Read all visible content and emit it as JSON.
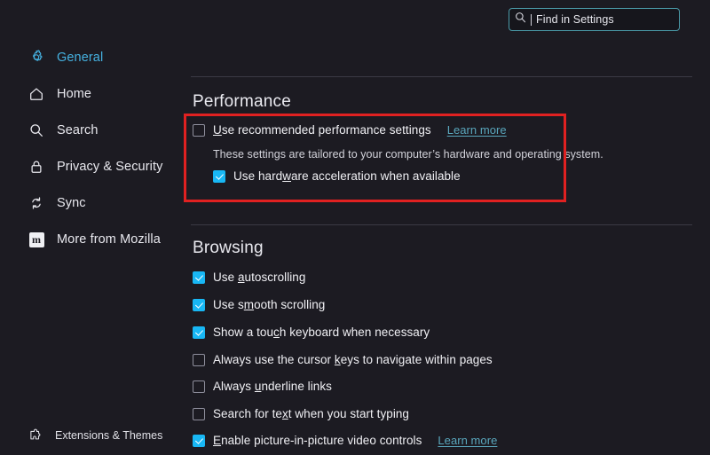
{
  "search": {
    "name": "find-in-settings",
    "placeholder": "Find in Settings",
    "value": "Find in Settings",
    "icon": "search-icon",
    "border_color": "#4a9aa8"
  },
  "sidebar": {
    "items": [
      {
        "label": "General",
        "icon": "gear-icon",
        "active": true
      },
      {
        "label": "Home",
        "icon": "home-icon",
        "active": false
      },
      {
        "label": "Search",
        "icon": "search-icon",
        "active": false
      },
      {
        "label": "Privacy & Security",
        "icon": "lock-icon",
        "active": false
      },
      {
        "label": "Sync",
        "icon": "sync-icon",
        "active": false
      },
      {
        "label": "More from Mozilla",
        "icon": "mozilla-m-icon",
        "active": false
      }
    ],
    "bottom": {
      "label": "Extensions & Themes",
      "icon": "puzzle-piece-icon"
    },
    "active_color": "#45b1e0"
  },
  "main": {
    "performance": {
      "title": "Performance",
      "recommended": {
        "label_pre": "U",
        "label_post": "se recommended performance settings",
        "checked": false,
        "link": "Learn more"
      },
      "description": "These settings are tailored to your computer’s hardware and operating system.",
      "hardware_acceleration": {
        "label_pre": "Use hard",
        "label_key": "w",
        "label_post": "are acceleration when available",
        "checked": true
      }
    },
    "browsing": {
      "title": "Browsing",
      "options": [
        {
          "pre": "Use ",
          "key": "a",
          "post": "utoscrolling",
          "checked": true,
          "link": null
        },
        {
          "pre": "Use s",
          "key": "m",
          "post": "ooth scrolling",
          "checked": true,
          "link": null
        },
        {
          "pre": "Show a tou",
          "key": "c",
          "post": "h keyboard when necessary",
          "checked": true,
          "link": null
        },
        {
          "pre": "Always use the cursor ",
          "key": "k",
          "post": "eys to navigate within pages",
          "checked": false,
          "link": null
        },
        {
          "pre": "Always ",
          "key": "u",
          "post": "nderline links",
          "checked": false,
          "link": null
        },
        {
          "pre": "Search for te",
          "key": "x",
          "post": "t when you start typing",
          "checked": false,
          "link": null
        },
        {
          "pre": "",
          "key": "E",
          "post": "nable picture-in-picture video controls",
          "checked": true,
          "link": "Learn more"
        }
      ]
    }
  },
  "annotation": {
    "highlight_color": "#e02121",
    "target": "performance-settings-group"
  },
  "colors": {
    "background": "#1c1b22",
    "text": "#fbfbfe",
    "checkbox_checked": "#18b7f4",
    "link": "#5aa7bd",
    "divider": "#3a3944"
  }
}
